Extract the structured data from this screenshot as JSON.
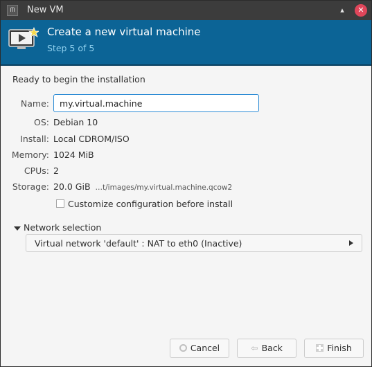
{
  "window": {
    "title": "New VM"
  },
  "titlebar": {
    "app_icon": "virt-manager-icon",
    "minimize": "▴",
    "close": "✕"
  },
  "banner": {
    "title": "Create a new virtual machine",
    "step": "Step 5 of 5",
    "icon": "vm-screen-icon"
  },
  "summary": {
    "heading": "Ready to begin the installation",
    "name_label": "Name:",
    "name_value": "my.virtual.machine",
    "os_label": "OS:",
    "os_value": "Debian 10",
    "install_label": "Install:",
    "install_value": "Local CDROM/ISO",
    "memory_label": "Memory:",
    "memory_value": "1024 MiB",
    "cpus_label": "CPUs:",
    "cpus_value": "2",
    "storage_label": "Storage:",
    "storage_size": "20.0 GiB",
    "storage_path": "…t/images/my.virtual.machine.qcow2"
  },
  "customize": {
    "label": "Customize configuration before install",
    "checked": false
  },
  "network": {
    "expander_label": "Network selection",
    "selected": "Virtual network 'default' : NAT to eth0 (Inactive)"
  },
  "buttons": {
    "cancel": "Cancel",
    "back": "Back",
    "finish": "Finish"
  },
  "colors": {
    "banner": "#0c6496",
    "step_text": "#8fd0ee",
    "focus": "#2a8ad4",
    "close": "#e0465a"
  }
}
